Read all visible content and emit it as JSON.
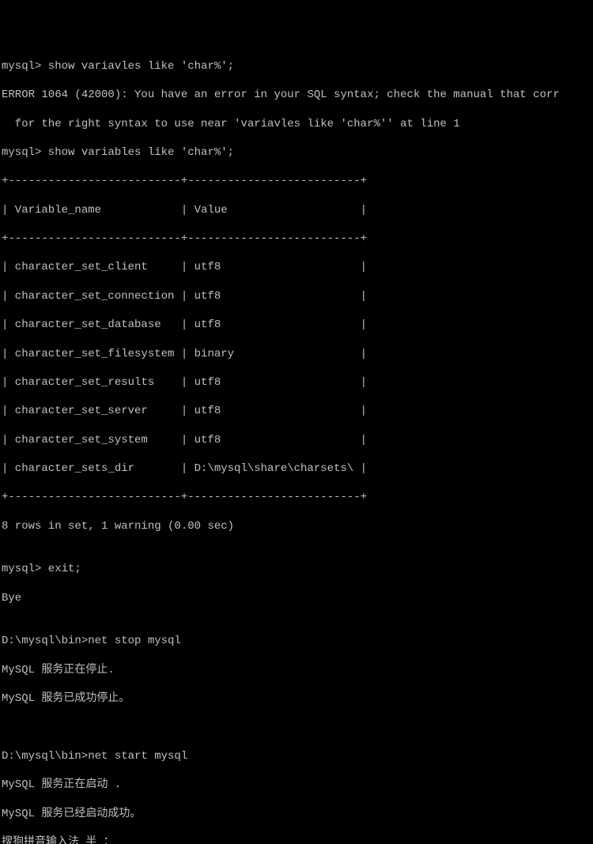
{
  "lines": {
    "l1": "mysql> show variavles like 'char%';",
    "l2": "ERROR 1064 (42000): You have an error in your SQL syntax; check the manual that corr",
    "l3": "  for the right syntax to use near 'variavles like 'char%'' at line 1",
    "l4": "mysql> show variables like 'char%';",
    "l5": "+--------------------------+--------------------------+",
    "l6": "| Variable_name            | Value                    |",
    "l7": "+--------------------------+--------------------------+",
    "l8": "| character_set_client     | utf8                     |",
    "l9": "| character_set_connection | utf8                     |",
    "l10": "| character_set_database   | utf8                     |",
    "l11": "| character_set_filesystem | binary                   |",
    "l12": "| character_set_results    | utf8                     |",
    "l13": "| character_set_server     | utf8                     |",
    "l14": "| character_set_system     | utf8                     |",
    "l15": "| character_sets_dir       | D:\\mysql\\share\\charsets\\ |",
    "l16": "+--------------------------+--------------------------+",
    "l17": "8 rows in set, 1 warning (0.00 sec)",
    "l18": "",
    "l19": "mysql> exit;",
    "l20": "Bye",
    "l21": "",
    "l22": "D:\\mysql\\bin>net stop mysql",
    "l23": "MySQL 服务正在停止.",
    "l24": "MySQL 服务已成功停止。",
    "l25": "",
    "l26": "",
    "l27": "D:\\mysql\\bin>net start mysql",
    "l28": "MySQL 服务正在启动 .",
    "l29": "MySQL 服务已经启动成功。",
    "l30": "搜狗拼音输入法 半 ："
  },
  "table_data": {
    "headers": [
      "Variable_name",
      "Value"
    ],
    "rows": [
      [
        "character_set_client",
        "utf8"
      ],
      [
        "character_set_connection",
        "utf8"
      ],
      [
        "character_set_database",
        "utf8"
      ],
      [
        "character_set_filesystem",
        "binary"
      ],
      [
        "character_set_results",
        "utf8"
      ],
      [
        "character_set_server",
        "utf8"
      ],
      [
        "character_set_system",
        "utf8"
      ],
      [
        "character_sets_dir",
        "D:\\mysql\\share\\charsets\\"
      ]
    ],
    "summary": "8 rows in set, 1 warning (0.00 sec)"
  }
}
